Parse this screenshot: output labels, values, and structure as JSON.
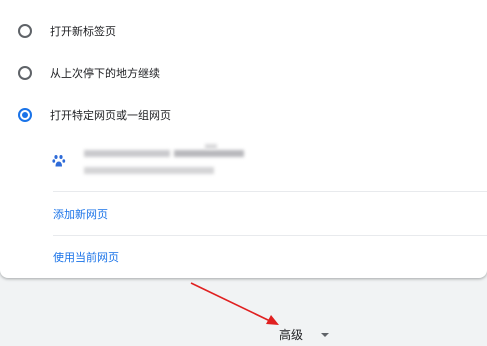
{
  "startup_options": [
    {
      "label": "打开新标签页",
      "selected": false
    },
    {
      "label": "从上次停下的地方继续",
      "selected": false
    },
    {
      "label": "打开特定网页或一组网页",
      "selected": true
    }
  ],
  "pages_section": {
    "favicon": "baidu-paw-icon",
    "add_page_link": "添加新网页",
    "use_current_link": "使用当前网页"
  },
  "advanced": {
    "label": "高级",
    "icon": "caret-down-icon"
  },
  "annotation": {
    "arrow_color": "#e02020"
  },
  "colors": {
    "accent": "#1a73e8",
    "background": "#f1f3f4"
  }
}
